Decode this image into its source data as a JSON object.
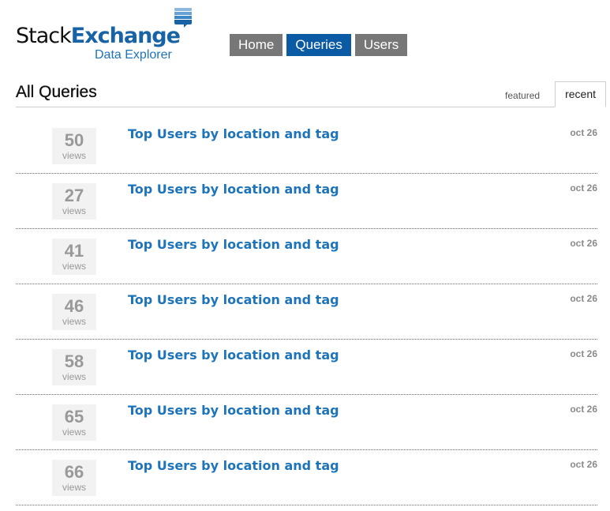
{
  "logo": {
    "title_part1": "Stack",
    "title_part2": "Exchange",
    "subtitle": "Data Explorer",
    "icon": "stack-exchange-logo-icon"
  },
  "nav": {
    "items": [
      {
        "label": "Home",
        "active": false
      },
      {
        "label": "Queries",
        "active": true
      },
      {
        "label": "Users",
        "active": false
      }
    ]
  },
  "page": {
    "title": "All Queries",
    "tabs": [
      {
        "label": "featured",
        "active": false
      },
      {
        "label": "recent",
        "active": true
      }
    ]
  },
  "queries": [
    {
      "views": "50",
      "views_label": "views",
      "title": "Top Users by location and tag",
      "date": "oct 26"
    },
    {
      "views": "27",
      "views_label": "views",
      "title": "Top Users by location and tag",
      "date": "oct 26"
    },
    {
      "views": "41",
      "views_label": "views",
      "title": "Top Users by location and tag",
      "date": "oct 26"
    },
    {
      "views": "46",
      "views_label": "views",
      "title": "Top Users by location and tag",
      "date": "oct 26"
    },
    {
      "views": "58",
      "views_label": "views",
      "title": "Top Users by location and tag",
      "date": "oct 26"
    },
    {
      "views": "65",
      "views_label": "views",
      "title": "Top Users by location and tag",
      "date": "oct 26"
    },
    {
      "views": "66",
      "views_label": "views",
      "title": "Top Users by location and tag",
      "date": "oct 26"
    }
  ],
  "colors": {
    "accent": "#0a5aa4",
    "link": "#1e74bb",
    "nav_inactive": "#777777",
    "muted": "#999999"
  }
}
